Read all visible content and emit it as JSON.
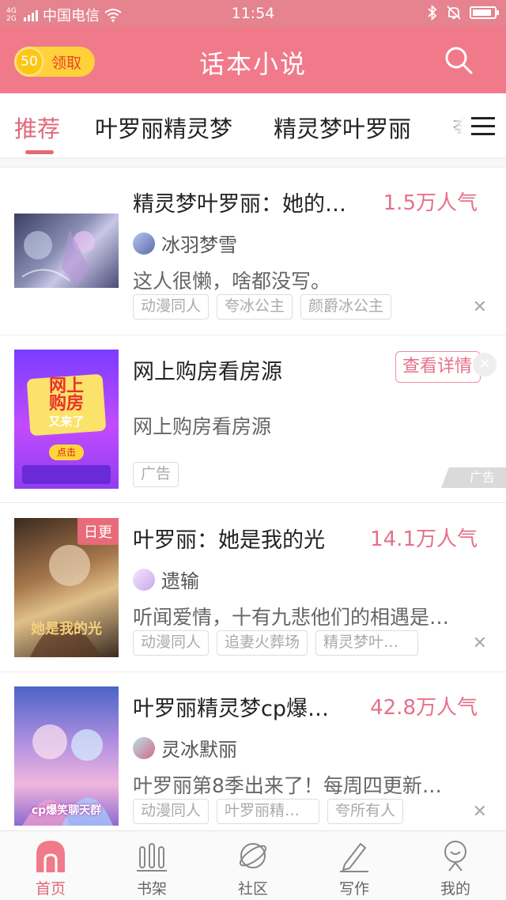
{
  "status_bar": {
    "network": "4G 2G",
    "carrier": "中国电信",
    "time": "11:54",
    "battery_level": 0.9
  },
  "header": {
    "coin_count": "50",
    "coin_label": "领取",
    "title": "话本小说"
  },
  "tabs": {
    "items": [
      "推荐",
      "叶罗丽精灵梦",
      "精灵梦叶罗丽",
      "夸"
    ],
    "active_index": 0
  },
  "feed": [
    {
      "title": "精灵梦叶罗丽：她的…",
      "popularity": "1.5万人气",
      "author": "冰羽梦雪",
      "desc": "这人很懒，啥都没写。",
      "tags": [
        "动漫同人",
        "夸冰公主",
        "颜爵冰公主"
      ]
    },
    {
      "ad": true,
      "title": "网上购房看房源",
      "button": "查看详情",
      "desc": "网上购房看房源",
      "tag": "广告",
      "ad_mark": "广告",
      "cover_text": {
        "line1": "网上",
        "line2": "购房",
        "line3": "又来了",
        "cta": "点击"
      }
    },
    {
      "title": "叶罗丽：她是我的光",
      "popularity": "14.1万人气",
      "author": "遗输",
      "badge": "日更",
      "desc": "听闻爱情，十有九悲他们的相遇是…",
      "tags": [
        "动漫同人",
        "追妻火葬场",
        "精灵梦叶…"
      ],
      "cover_text": "她是我的光"
    },
    {
      "title": "叶罗丽精灵梦cp爆…",
      "popularity": "42.8万人气",
      "author": "灵冰默丽",
      "desc": "叶罗丽第8季出来了！每周四更新…",
      "tags": [
        "动漫同人",
        "叶罗丽精…",
        "夸所有人"
      ],
      "cover_text": "cp爆笑聊天群"
    }
  ],
  "bottom_nav": {
    "items": [
      "首页",
      "书架",
      "社区",
      "写作",
      "我的"
    ],
    "active_index": 0
  },
  "colors": {
    "accent": "#f07a8a",
    "accent_text": "#e2687a",
    "coin": "#ffd23a"
  }
}
